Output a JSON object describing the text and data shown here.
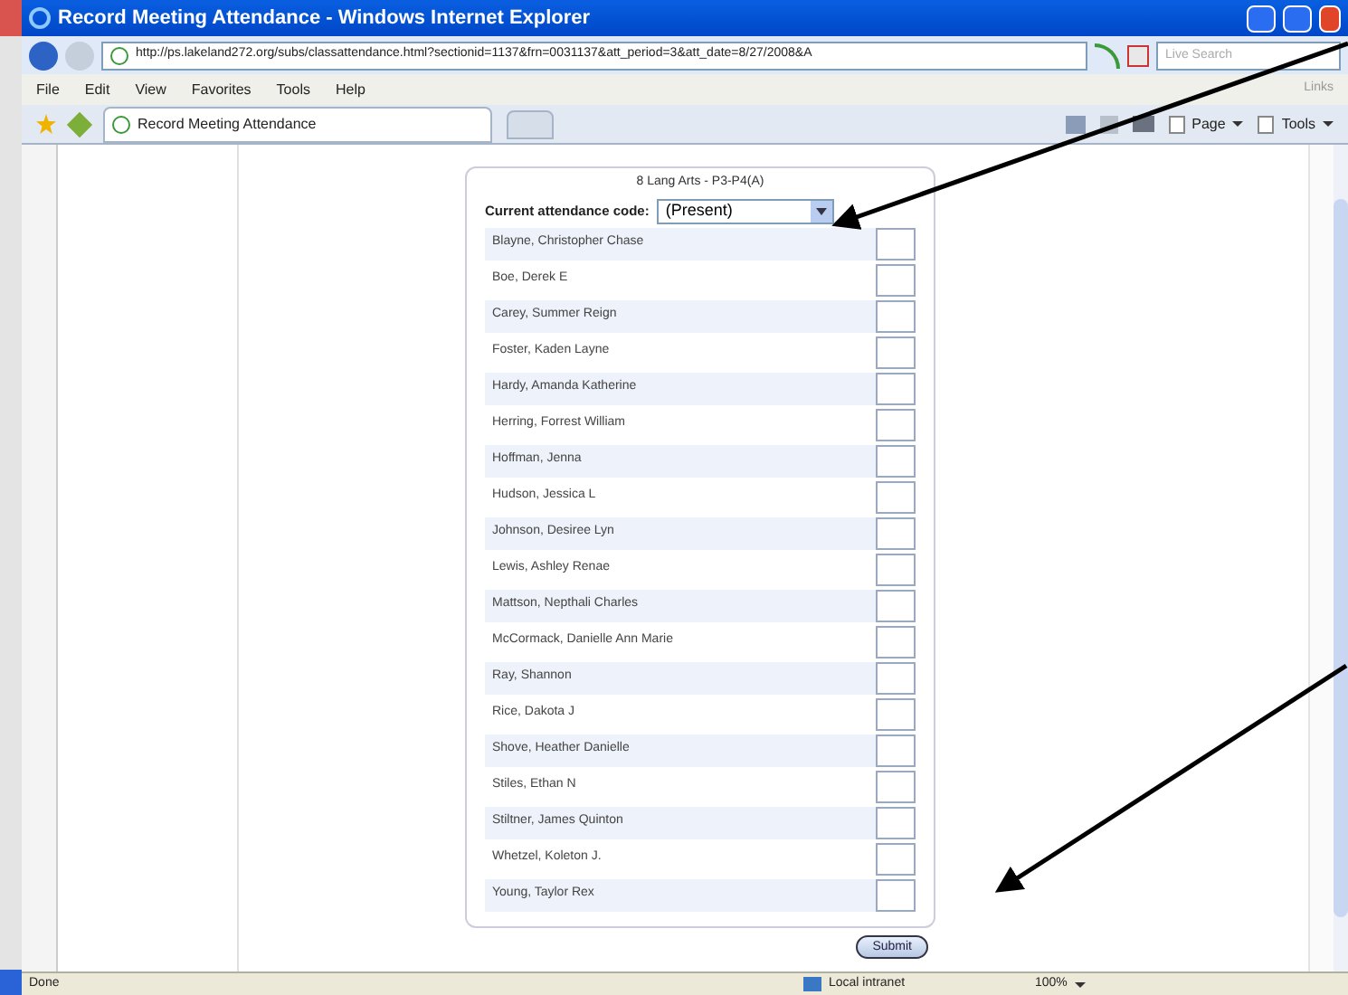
{
  "window": {
    "title": "Record Meeting Attendance - Windows Internet Explorer"
  },
  "address_bar": {
    "url": "http://ps.lakeland272.org/subs/classattendance.html?sectionid=1137&frn=0031137&att_period=3&att_date=8/27/2008&A",
    "search_placeholder": "Live Search"
  },
  "menu": [
    "File",
    "Edit",
    "View",
    "Favorites",
    "Tools",
    "Help"
  ],
  "links_label": "Links",
  "tab": {
    "label": "Record Meeting Attendance"
  },
  "command_bar": [
    "Page",
    "Tools"
  ],
  "form": {
    "title": "8 Lang Arts - P3-P4(A)",
    "code_label": "Current attendance code:",
    "code_value": "(Present)",
    "students": [
      {
        "name": "Blayne, Christopher Chase",
        "checked": false
      },
      {
        "name": "Boe, Derek E",
        "checked": false
      },
      {
        "name": "Carey, Summer Reign",
        "checked": false
      },
      {
        "name": "Foster, Kaden Layne",
        "checked": false
      },
      {
        "name": "Hardy, Amanda Katherine",
        "checked": false
      },
      {
        "name": "Herring, Forrest William",
        "checked": false
      },
      {
        "name": "Hoffman, Jenna",
        "checked": false
      },
      {
        "name": "Hudson, Jessica L",
        "checked": false
      },
      {
        "name": "Johnson, Desiree Lyn",
        "checked": false
      },
      {
        "name": "Lewis, Ashley Renae",
        "checked": false
      },
      {
        "name": "Mattson, Nepthali Charles",
        "checked": false
      },
      {
        "name": "McCormack, Danielle Ann Marie",
        "checked": false
      },
      {
        "name": "Ray, Shannon",
        "checked": false
      },
      {
        "name": "Rice, Dakota J",
        "checked": false
      },
      {
        "name": "Shove, Heather Danielle",
        "checked": false
      },
      {
        "name": "Stiles, Ethan N",
        "checked": false
      },
      {
        "name": "Stiltner, James Quinton",
        "checked": false
      },
      {
        "name": "Whetzel, Koleton J.",
        "checked": false
      },
      {
        "name": "Young, Taylor Rex",
        "checked": false
      }
    ],
    "submit": "Submit"
  },
  "status_bar": {
    "status": "Done",
    "zone": "Local intranet",
    "zoom": "100%"
  }
}
